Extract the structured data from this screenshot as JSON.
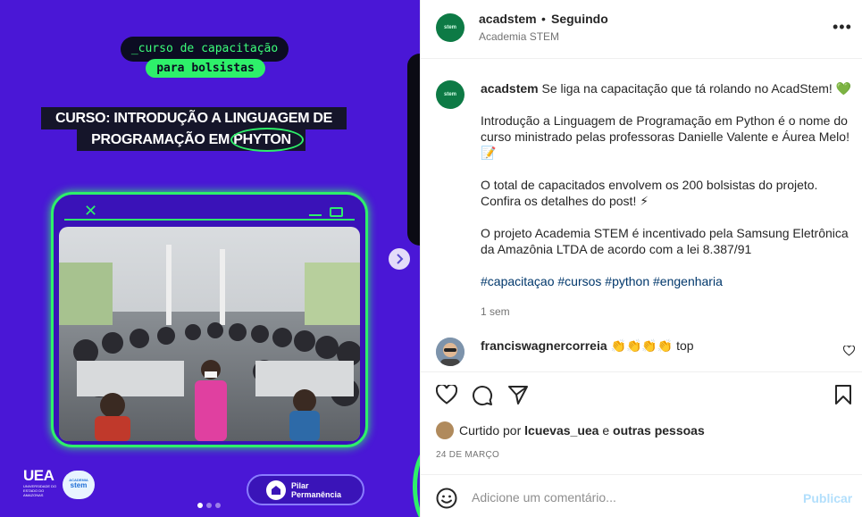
{
  "media": {
    "pill_top": "_curso de capacitação",
    "pill_bottom": "para bolsistas",
    "title_line1": "CURSO: INTRODUÇÃO A LINGUAGEM DE",
    "title_line2": "PROGRAMAÇÃO EM PHYTON",
    "uea_logo": "UEA",
    "uea_sub": "UNIVERSIDADE DO ESTADO DO AMAZONAS",
    "stem_badge_top": "ACADEMIA",
    "stem_badge": "stem",
    "pilar_line1": "Pilar",
    "pilar_line2": "Permanência",
    "carousel_count": 3,
    "carousel_active": 0
  },
  "header": {
    "username": "acadstem",
    "separator": "•",
    "follow_status": "Seguindo",
    "subtitle": "Academia STEM",
    "avatar_text": "stem"
  },
  "caption": {
    "username": "acadstem",
    "line1": "Se liga na capacitação que tá rolando no AcadStem! 💚",
    "p2": "Introdução a Linguagem de Programação em Python é o nome do curso ministrado pelas professoras Danielle Valente e Áurea Melo! 📝",
    "p3": "O total de capacitados envolvem os 200 bolsistas do projeto. Confira os detalhes do post! ⚡",
    "p4": "O projeto Academia STEM é incentivado pela Samsung Eletrônica da Amazônia LTDA de acordo com a lei 8.387/91",
    "hashtags": "#capacitaçao #cursos #python #engenharia",
    "time": "1 sem"
  },
  "comment": {
    "username": "franciswagnercorreia",
    "text": "👏👏👏👏 top"
  },
  "likes": {
    "prefix": "Curtido por",
    "user": "lcuevas_uea",
    "conj": "e",
    "others": "outras pessoas"
  },
  "date": "24 DE MARÇO",
  "comment_box": {
    "placeholder": "Adicione um comentário...",
    "post_label": "Publicar"
  },
  "colors": {
    "media_bg": "#4a17d6",
    "neon_green": "#2ef06a",
    "link": "#00376b",
    "post_disabled": "#b2dffc"
  }
}
